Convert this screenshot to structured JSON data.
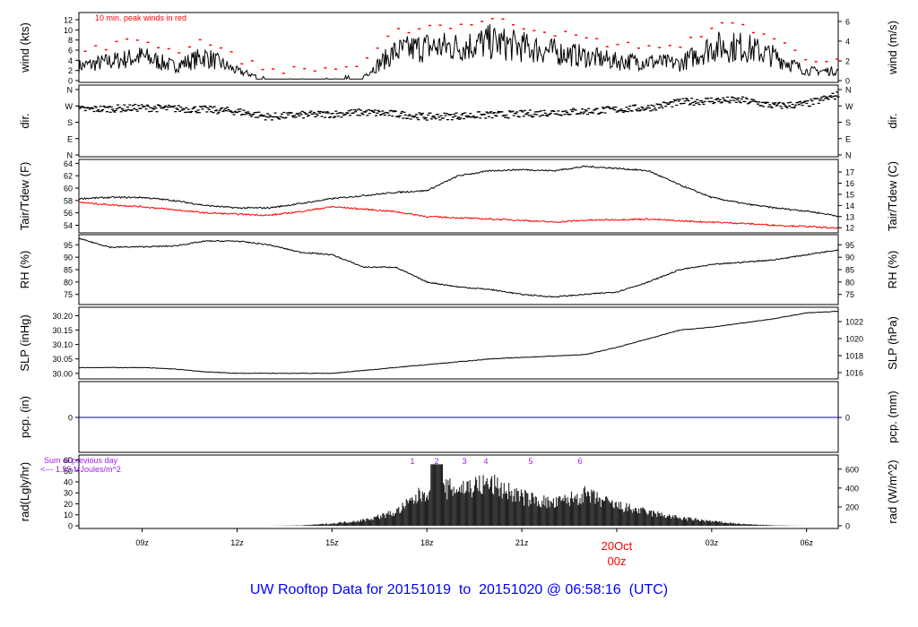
{
  "title": "UW Rooftop Data for 20151019  to  20151020 @ 06:58:16  (UTC)",
  "colors": {
    "obs": "#000000",
    "dew": "#ff0000",
    "pcp": "#0000ff",
    "title": "#0000ff",
    "note": "#a020f0",
    "date": "#ff0000"
  },
  "chart_data": [
    {
      "type": "line",
      "id": "wind",
      "ylabel": "wind (kts)",
      "ylabel_right": "wind (m/s)",
      "annotation": "10 min. peak winds in red",
      "ylim": [
        0,
        13
      ],
      "ticks": [
        0,
        2,
        4,
        6,
        8,
        10,
        12
      ],
      "rticks": [
        0,
        2,
        4,
        6
      ],
      "values": [
        3,
        4,
        5,
        3,
        5,
        2,
        0.3,
        0.3,
        0.5,
        1,
        6,
        7,
        7,
        8,
        7,
        6,
        5,
        4,
        4,
        3.5,
        7,
        7,
        5,
        2,
        2
      ]
    },
    {
      "type": "scatter",
      "id": "dir",
      "ylabel": "dir.",
      "ylabel_right": "dir.",
      "ylim": [
        0,
        360
      ],
      "ticks": [
        {
          "v": 0,
          "l": "N"
        },
        {
          "v": 90,
          "l": "E"
        },
        {
          "v": 180,
          "l": "S"
        },
        {
          "v": 270,
          "l": "W"
        },
        {
          "v": 360,
          "l": "N"
        }
      ],
      "values": [
        250,
        255,
        260,
        255,
        250,
        240,
        210,
        220,
        225,
        235,
        225,
        210,
        215,
        220,
        225,
        235,
        240,
        250,
        260,
        290,
        300,
        300,
        270,
        280,
        330
      ]
    },
    {
      "type": "line",
      "id": "temp",
      "ylabel": "Tair/Tdew (F)",
      "ylabel_right": "Tair/Tdew (C)",
      "ylim": [
        53.2,
        64.2
      ],
      "ticks": [
        54,
        56,
        58,
        60,
        62,
        64
      ],
      "rticks": [
        12,
        13,
        14,
        15,
        16,
        17
      ],
      "series": [
        {
          "name": "Tair",
          "values": [
            58.3,
            58.5,
            58.5,
            58,
            57.2,
            56.8,
            56.8,
            57.5,
            58.3,
            58.8,
            59.3,
            59.6,
            62,
            62.8,
            63,
            62.8,
            63.5,
            63.2,
            62.8,
            60.5,
            58.5,
            57.5,
            56.8,
            56.3,
            55.5
          ]
        },
        {
          "name": "Tdew",
          "values": [
            57.7,
            57.3,
            57,
            56.5,
            56,
            55.8,
            55.6,
            56.2,
            57,
            56.6,
            56.2,
            55.4,
            55.2,
            55,
            54.8,
            54.5,
            54.8,
            54.9,
            55,
            54.7,
            54.5,
            54.3,
            54,
            53.8,
            53.5
          ]
        }
      ]
    },
    {
      "type": "line",
      "id": "rh",
      "ylabel": "RH (%)",
      "ylabel_right": "RH (%)",
      "ylim": [
        72,
        98
      ],
      "ticks": [
        75,
        80,
        85,
        90,
        95
      ],
      "rticks": [
        75,
        80,
        85,
        90,
        95
      ],
      "values": [
        97.5,
        94,
        94.2,
        94.5,
        96.5,
        96.5,
        95,
        92,
        91,
        86,
        86,
        80,
        78,
        77,
        75,
        74,
        75,
        76,
        80,
        85,
        87,
        88,
        89,
        91,
        93
      ]
    },
    {
      "type": "line",
      "id": "slp",
      "ylabel": "SLP (inHg)",
      "ylabel_right": "SLP (hPa)",
      "ylim": [
        29.99,
        30.22
      ],
      "ticks": [
        "30.00",
        "30.05",
        "30.10",
        "30.15",
        "30.20"
      ],
      "rticks": [
        1016,
        1018,
        1020,
        1022
      ],
      "values": [
        30.02,
        30.02,
        30.02,
        30.015,
        30.005,
        30,
        30,
        30,
        30,
        30.01,
        30.02,
        30.03,
        30.04,
        30.05,
        30.055,
        30.06,
        30.065,
        30.09,
        30.12,
        30.15,
        30.16,
        30.175,
        30.19,
        30.21,
        30.215
      ]
    },
    {
      "type": "line",
      "id": "pcp",
      "ylabel": "pcp. (in)",
      "ylabel_right": "pcp. (mm)",
      "ticks": [
        0
      ],
      "rticks": [
        0
      ],
      "values": [
        0
      ]
    },
    {
      "type": "bar",
      "id": "rad",
      "ylabel": "rad(Lgly/hr)",
      "ylabel_right": "rad (W/m^2)",
      "ylim": [
        0,
        62
      ],
      "ticks": [
        0,
        10,
        20,
        30,
        40,
        50,
        60
      ],
      "rticks": [
        0,
        200,
        400,
        600
      ],
      "note": [
        "Sum of previous day",
        "<--- 1.55 MJoules/m^2"
      ],
      "markers": [
        "1",
        "2",
        "3",
        "4",
        "5",
        "6"
      ],
      "values": [
        0,
        0,
        0,
        0,
        0,
        0,
        0,
        0.3,
        2,
        5,
        12,
        32,
        34,
        38,
        26,
        20,
        28,
        18,
        12,
        7,
        4,
        1.5,
        0.3,
        0,
        0
      ]
    }
  ],
  "xaxis": {
    "ticks": [
      "09z",
      "12z",
      "15z",
      "18z",
      "21z",
      "00z",
      "03z",
      "06z"
    ],
    "date": "20Oct",
    "date_hour": "00z"
  }
}
